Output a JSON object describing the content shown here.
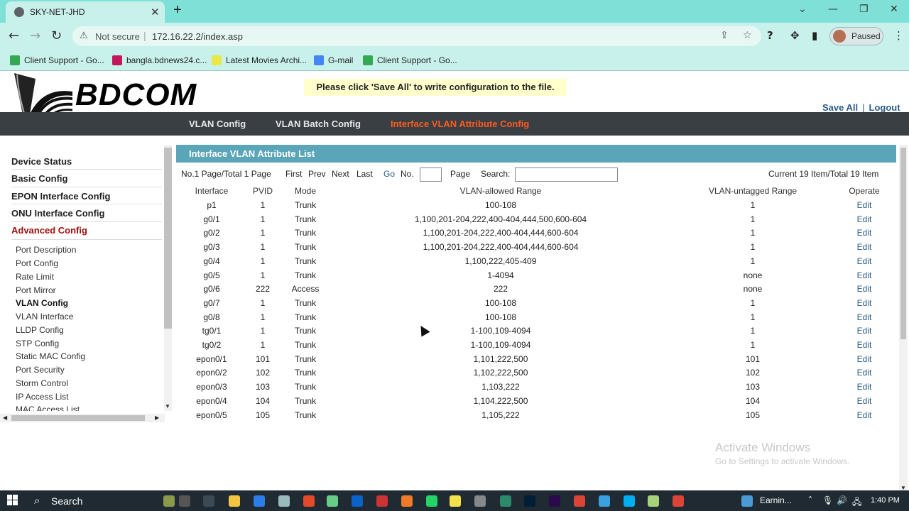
{
  "browser": {
    "tab_title": "SKY-NET-JHD",
    "tab_close": "✕",
    "new_tab": "+",
    "not_secure": "Not secure",
    "url": "172.16.22.2/index.asp",
    "profile_status": "Paused",
    "bookmarks": [
      {
        "label": "Client Support - Go...",
        "color": "#34a853"
      },
      {
        "label": "bangla.bdnews24.c...",
        "color": "#c2185b"
      },
      {
        "label": "Latest Movies Archi...",
        "color": "#e8e84a"
      },
      {
        "label": "G-mail",
        "color": "#4285f4"
      },
      {
        "label": "Client Support - Go...",
        "color": "#34a853"
      }
    ]
  },
  "header": {
    "logo_text": "BDCOM",
    "notice": "Please click 'Save All' to write configuration to the file.",
    "save_all": "Save All",
    "separator": "|",
    "logout": "Logout"
  },
  "nav": {
    "items": [
      {
        "label": "VLAN Config"
      },
      {
        "label": "VLAN Batch Config"
      },
      {
        "label": "Interface VLAN Attribute Config"
      }
    ]
  },
  "sidebar": {
    "sections": [
      {
        "label": "Device Status"
      },
      {
        "label": "Basic Config"
      },
      {
        "label": "EPON Interface Config"
      },
      {
        "label": "ONU Interface Config"
      },
      {
        "label": "Advanced Config"
      }
    ],
    "items": [
      {
        "label": "Port Description"
      },
      {
        "label": "Port Config"
      },
      {
        "label": "Rate Limit"
      },
      {
        "label": "Port Mirror"
      },
      {
        "label": "VLAN Config"
      },
      {
        "label": "VLAN Interface"
      },
      {
        "label": "LLDP Config"
      },
      {
        "label": "STP Config"
      },
      {
        "label": "Static MAC Config"
      },
      {
        "label": "Port Security"
      },
      {
        "label": "Storm Control"
      },
      {
        "label": "IP Access List"
      },
      {
        "label": "MAC Access List"
      }
    ]
  },
  "panel": {
    "title": "Interface VLAN Attribute List",
    "page_info": "No.1 Page/Total 1 Page",
    "first": "First",
    "prev": "Prev",
    "next": "Next",
    "last": "Last",
    "go": "Go",
    "no_label": "No.",
    "page_label": "Page",
    "search_label": "Search:",
    "item_info": "Current 19 Item/Total 19 Item",
    "columns": [
      "Interface",
      "PVID",
      "Mode",
      "VLAN-allowed Range",
      "VLAN-untagged Range",
      "Operate"
    ],
    "rows": [
      {
        "iface": "p1",
        "pvid": "1",
        "mode": "Trunk",
        "allowed": "100-108",
        "untagged": "1",
        "op": "Edit"
      },
      {
        "iface": "g0/1",
        "pvid": "1",
        "mode": "Trunk",
        "allowed": "1,100,201-204,222,400-404,444,500,600-604",
        "untagged": "1",
        "op": "Edit"
      },
      {
        "iface": "g0/2",
        "pvid": "1",
        "mode": "Trunk",
        "allowed": "1,100,201-204,222,400-404,444,600-604",
        "untagged": "1",
        "op": "Edit"
      },
      {
        "iface": "g0/3",
        "pvid": "1",
        "mode": "Trunk",
        "allowed": "1,100,201-204,222,400-404,444,600-604",
        "untagged": "1",
        "op": "Edit"
      },
      {
        "iface": "g0/4",
        "pvid": "1",
        "mode": "Trunk",
        "allowed": "1,100,222,405-409",
        "untagged": "1",
        "op": "Edit"
      },
      {
        "iface": "g0/5",
        "pvid": "1",
        "mode": "Trunk",
        "allowed": "1-4094",
        "untagged": "none",
        "op": "Edit"
      },
      {
        "iface": "g0/6",
        "pvid": "222",
        "mode": "Access",
        "allowed": "222",
        "untagged": "none",
        "op": "Edit"
      },
      {
        "iface": "g0/7",
        "pvid": "1",
        "mode": "Trunk",
        "allowed": "100-108",
        "untagged": "1",
        "op": "Edit"
      },
      {
        "iface": "g0/8",
        "pvid": "1",
        "mode": "Trunk",
        "allowed": "100-108",
        "untagged": "1",
        "op": "Edit"
      },
      {
        "iface": "tg0/1",
        "pvid": "1",
        "mode": "Trunk",
        "allowed": "1-100,109-4094",
        "untagged": "1",
        "op": "Edit"
      },
      {
        "iface": "tg0/2",
        "pvid": "1",
        "mode": "Trunk",
        "allowed": "1-100,109-4094",
        "untagged": "1",
        "op": "Edit"
      },
      {
        "iface": "epon0/1",
        "pvid": "101",
        "mode": "Trunk",
        "allowed": "1,101,222,500",
        "untagged": "101",
        "op": "Edit"
      },
      {
        "iface": "epon0/2",
        "pvid": "102",
        "mode": "Trunk",
        "allowed": "1,102,222,500",
        "untagged": "102",
        "op": "Edit"
      },
      {
        "iface": "epon0/3",
        "pvid": "103",
        "mode": "Trunk",
        "allowed": "1,103,222",
        "untagged": "103",
        "op": "Edit"
      },
      {
        "iface": "epon0/4",
        "pvid": "104",
        "mode": "Trunk",
        "allowed": "1,104,222,500",
        "untagged": "104",
        "op": "Edit"
      },
      {
        "iface": "epon0/5",
        "pvid": "105",
        "mode": "Trunk",
        "allowed": "1,105,222",
        "untagged": "105",
        "op": "Edit"
      }
    ]
  },
  "watermark": {
    "line1": "Activate Windows",
    "line2": "Go to Settings to activate Windows."
  },
  "taskbar": {
    "search": "Search",
    "earnings": "Earnin...",
    "time": "1:40 PM"
  }
}
